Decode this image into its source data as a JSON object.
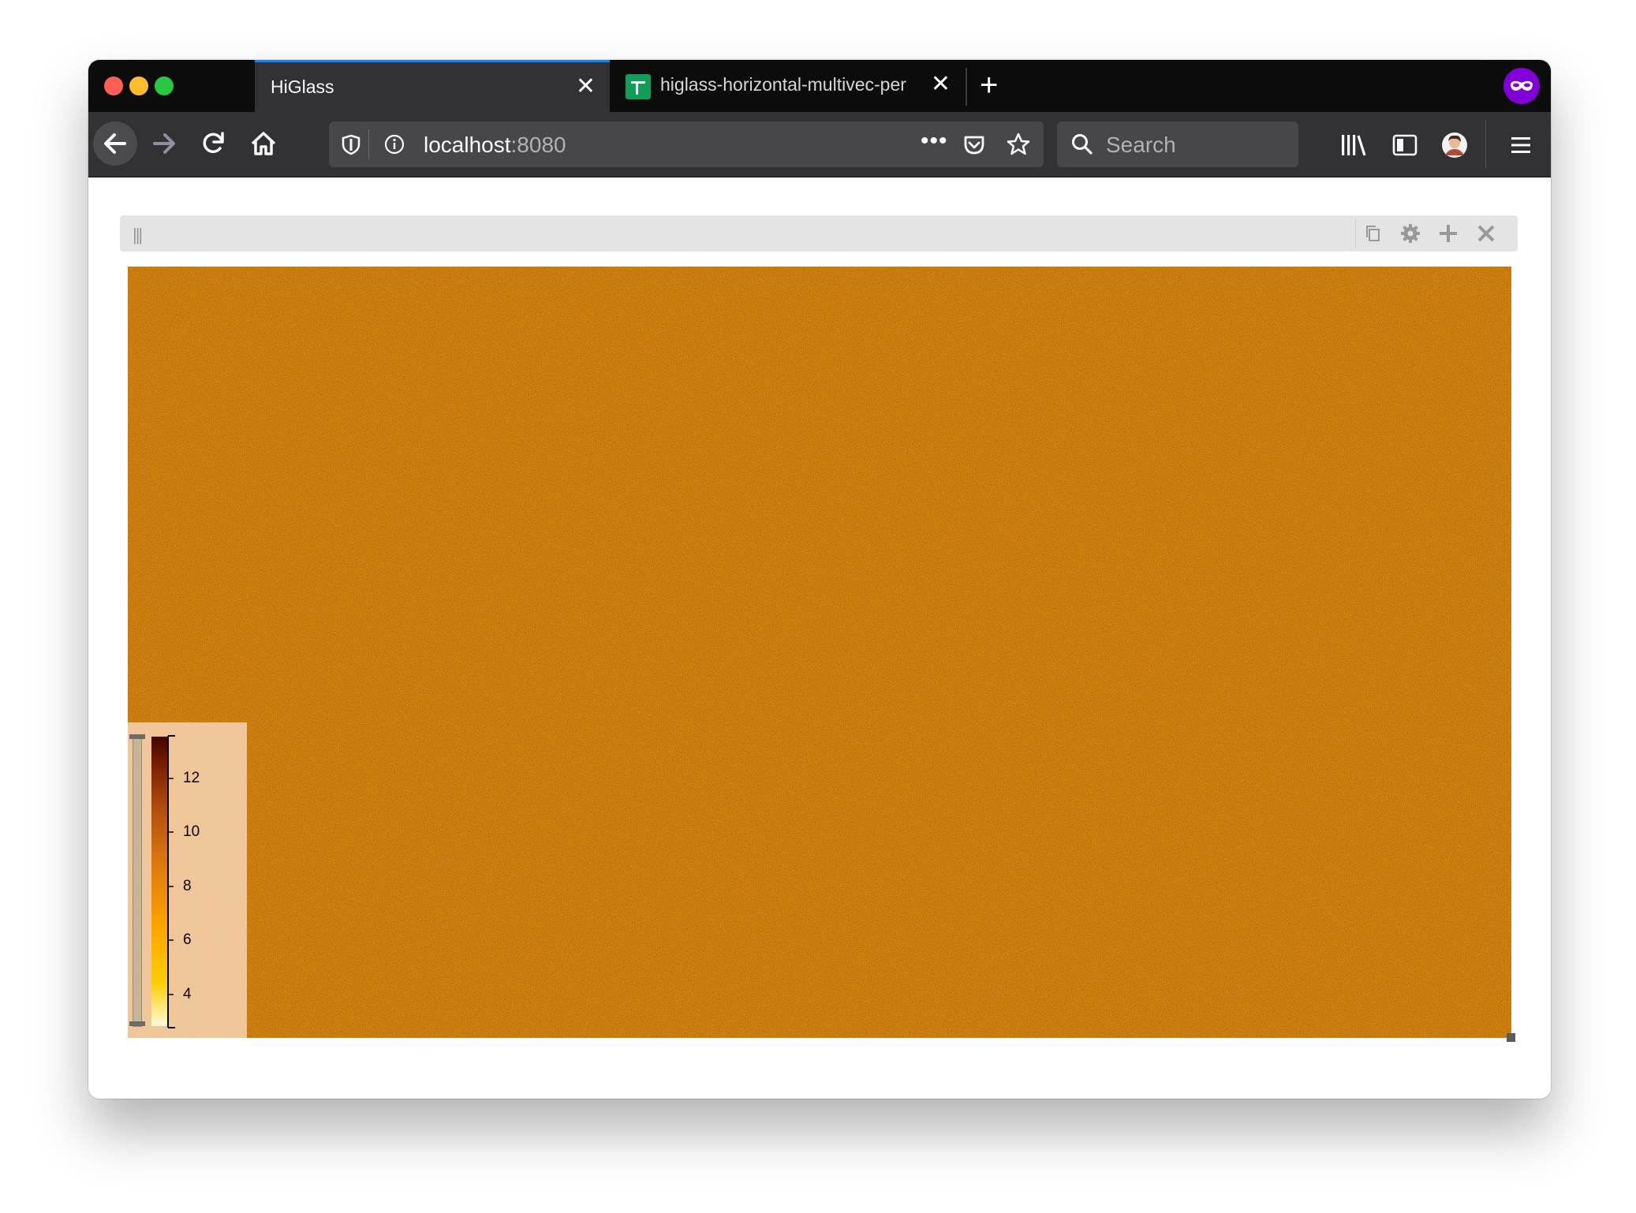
{
  "browser": {
    "tabs": [
      {
        "title": "HiGlass",
        "active": true
      },
      {
        "title": "higlass-horizontal-multivec-per",
        "active": false
      }
    ],
    "url": {
      "host": "localhost",
      "port": ":8080"
    },
    "search_placeholder": "Search",
    "traffic_colors": [
      "#ff5f57",
      "#febc2e",
      "#28c840"
    ],
    "accent": "#0a84ff",
    "private_badge_color": "#8000d7"
  },
  "view": {
    "header_grip": "|||",
    "header_icons": [
      "copy-icon",
      "gear-icon",
      "plus-icon",
      "close-icon"
    ]
  },
  "heatmap": {
    "base_color": "#d98512",
    "colorscale": [
      "#ffffe0",
      "#ffa500",
      "#d2691e",
      "#4a0000"
    ],
    "colorbar": {
      "ticks": [
        "12",
        "10",
        "8",
        "6",
        "4"
      ]
    }
  }
}
